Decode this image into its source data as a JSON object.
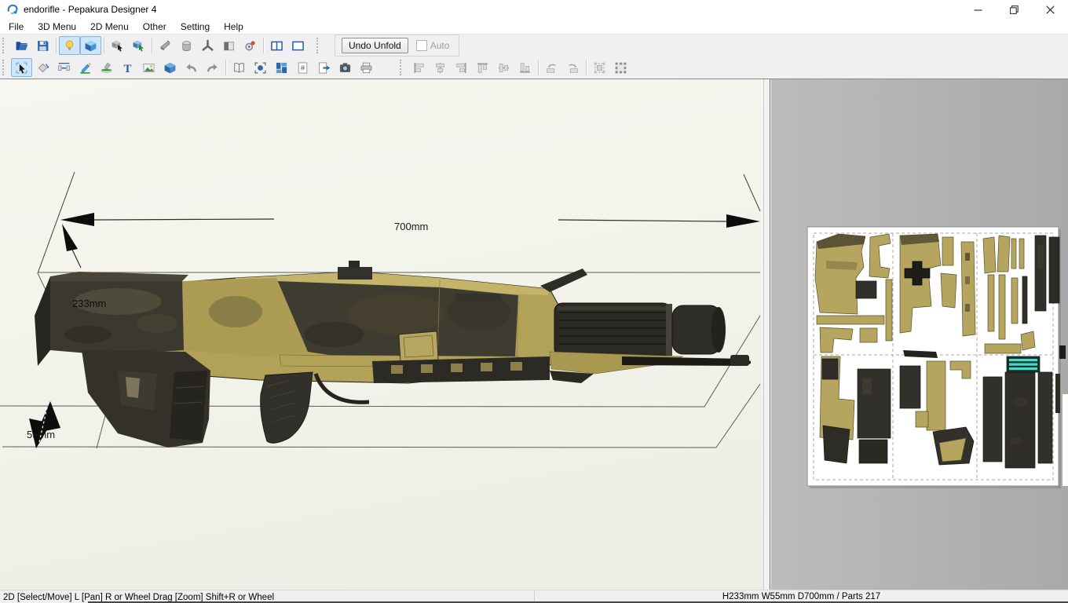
{
  "window": {
    "title": "endorifle - Pepakura Designer 4"
  },
  "menu": {
    "items": [
      "File",
      "3D Menu",
      "2D Menu",
      "Other",
      "Setting",
      "Help"
    ]
  },
  "toolbar_top": {
    "unfold": {
      "undo_button": "Undo Unfold",
      "auto_checkbox": "Auto",
      "auto_checked": false
    },
    "items": [
      {
        "name": "open-file",
        "icon": "folder-open-icon"
      },
      {
        "name": "save-file",
        "icon": "save-icon"
      },
      {
        "sep": true
      },
      {
        "name": "toggle-light",
        "icon": "light-bulb-icon",
        "active": true
      },
      {
        "name": "toggle-texture",
        "icon": "textured-cube-icon",
        "active": true
      },
      {
        "sep": true
      },
      {
        "name": "select-3d",
        "icon": "cube-select-icon"
      },
      {
        "name": "select-through-3d",
        "icon": "cube-select-through-icon"
      },
      {
        "sep": true
      },
      {
        "name": "edge-style",
        "icon": "wedge-icon"
      },
      {
        "name": "smooth-cylinder",
        "icon": "cylinder-icon"
      },
      {
        "name": "rotation-axis",
        "icon": "caltrop-icon"
      },
      {
        "name": "split-model",
        "icon": "half-box-icon"
      },
      {
        "name": "view-reset",
        "icon": "view-rotate-icon"
      },
      {
        "sep": true
      },
      {
        "name": "layout-both-panes",
        "icon": "two-pane-icon"
      },
      {
        "name": "layout-single-pane",
        "icon": "one-pane-icon"
      }
    ]
  },
  "toolbar_2d": {
    "items": [
      {
        "name": "select-move",
        "icon": "cursor-select-icon",
        "active": true
      },
      {
        "name": "rotate-part",
        "icon": "rotate-diamond-icon"
      },
      {
        "name": "divide-join-parts",
        "icon": "distribute-icon"
      },
      {
        "name": "edit-flaps",
        "icon": "pencil-icon"
      },
      {
        "name": "paint-fill",
        "icon": "brush-icon"
      },
      {
        "name": "insert-text",
        "icon": "text-icon"
      },
      {
        "name": "insert-image",
        "icon": "image-icon"
      },
      {
        "name": "show-corresponding-face",
        "icon": "cube-blue-icon"
      },
      {
        "name": "undo",
        "icon": "undo-icon"
      },
      {
        "name": "redo",
        "icon": "redo-icon"
      },
      {
        "sep": true
      },
      {
        "name": "check-fold-line",
        "icon": "book-icon"
      },
      {
        "name": "focus-selection",
        "icon": "target-icon"
      },
      {
        "name": "auto-arrange",
        "icon": "arrange-icon"
      },
      {
        "name": "page-numbering",
        "icon": "page-number-icon"
      },
      {
        "name": "move-to-page",
        "icon": "page-export-icon"
      },
      {
        "name": "capture-view",
        "icon": "camera-icon"
      },
      {
        "name": "print",
        "icon": "printer-icon"
      },
      {
        "gap": true
      },
      {
        "name": "align-left",
        "icon": "align-left-icon",
        "disabled": true
      },
      {
        "name": "align-center-horizontal",
        "icon": "align-center-h-icon",
        "disabled": true
      },
      {
        "name": "align-right",
        "icon": "align-right-icon",
        "disabled": true
      },
      {
        "name": "align-top",
        "icon": "align-top-icon",
        "disabled": true
      },
      {
        "name": "align-middle-vertical",
        "icon": "align-middle-v-icon",
        "disabled": true
      },
      {
        "name": "align-bottom",
        "icon": "align-bottom-icon",
        "disabled": true
      },
      {
        "sep": true
      },
      {
        "name": "rotate-counterclockwise",
        "icon": "rotate-ccw-icon",
        "disabled": true
      },
      {
        "name": "rotate-clockwise",
        "icon": "rotate-cw-icon",
        "disabled": true
      },
      {
        "sep": true
      },
      {
        "name": "group-parts",
        "icon": "group-icon",
        "disabled": true
      },
      {
        "name": "ungroup-parts",
        "icon": "ungroup-icon",
        "disabled": true
      }
    ]
  },
  "viewport3d": {
    "width_label": "700mm",
    "height_label": "233mm",
    "depth_label": "55mm"
  },
  "statusbar": {
    "left": "2D [Select/Move] L [Pan] R or Wheel Drag [Zoom] Shift+R or Wheel",
    "right": "H233mm W55mm D700mm / Parts 217"
  },
  "colors": {
    "accent_blue": "#2c66ad",
    "active_button_bg": "#cfe5f8",
    "khaki": "#b2a257",
    "dark_part": "#32302a",
    "teal_part": "#43dcc9",
    "viewport_bg": "#f3f3ec",
    "pane2d_bg": "#b2b2b2"
  }
}
